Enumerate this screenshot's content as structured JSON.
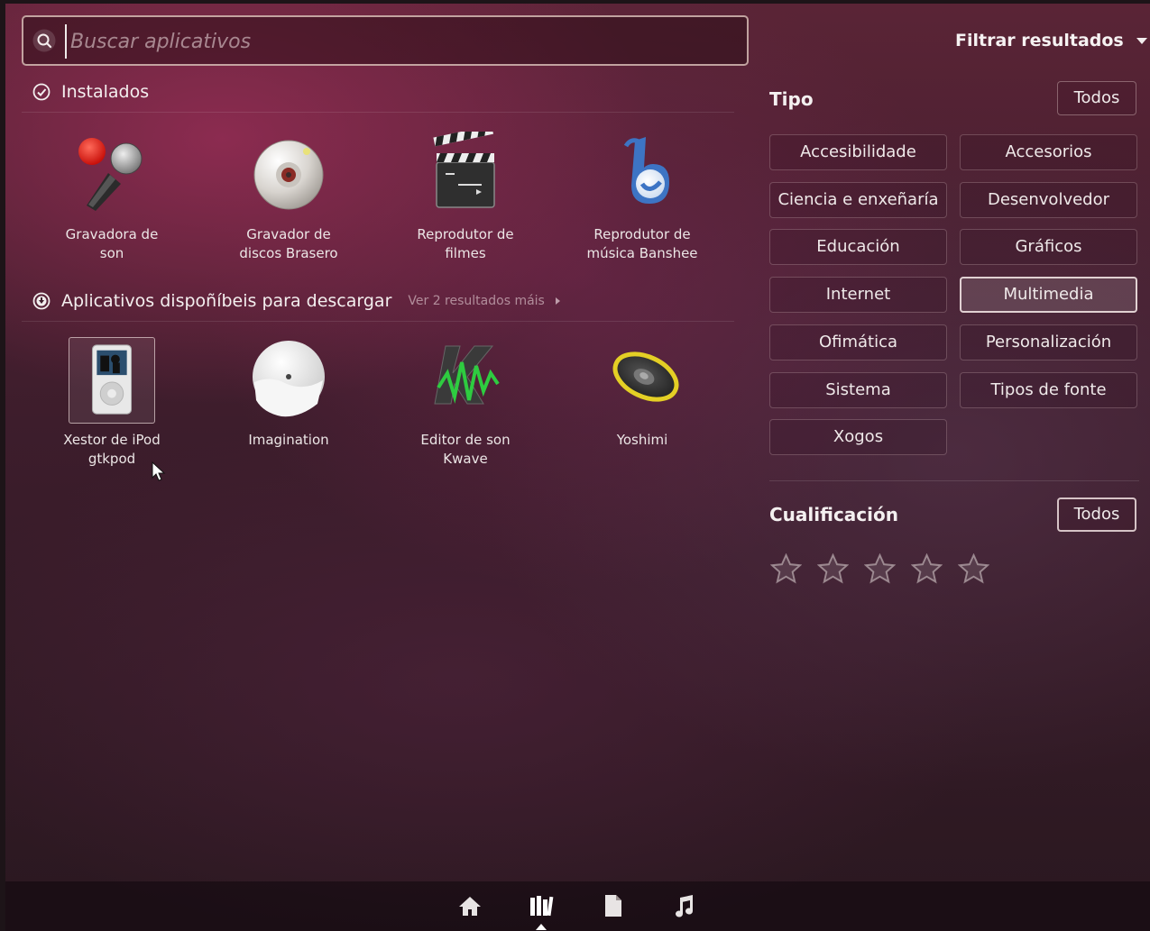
{
  "search": {
    "placeholder": "Buscar aplicativos",
    "value": ""
  },
  "filter": {
    "header_label": "Filtrar resultados",
    "tipo": {
      "title": "Tipo",
      "all_label": "Todos",
      "options": [
        {
          "label": "Accesibilidade",
          "active": false
        },
        {
          "label": "Accesorios",
          "active": false
        },
        {
          "label": "Ciencia e enxeñaría",
          "active": false
        },
        {
          "label": "Desenvolvedor",
          "active": false
        },
        {
          "label": "Educación",
          "active": false
        },
        {
          "label": "Gráficos",
          "active": false
        },
        {
          "label": "Internet",
          "active": false
        },
        {
          "label": "Multimedia",
          "active": true
        },
        {
          "label": "Ofimática",
          "active": false
        },
        {
          "label": "Personalización",
          "active": false
        },
        {
          "label": "Sistema",
          "active": false
        },
        {
          "label": "Tipos de fonte",
          "active": false
        },
        {
          "label": "Xogos",
          "active": false
        }
      ]
    },
    "rating": {
      "title": "Cualificación",
      "all_label": "Todos",
      "stars": 5,
      "star_icon": "star-outline-icon"
    }
  },
  "installed": {
    "title": "Instalados",
    "icon": "check-circle-icon",
    "apps": [
      {
        "label": "Gravadora de\nson",
        "icon": "microphone-icon"
      },
      {
        "label": "Gravador de\ndiscos Brasero",
        "icon": "disc-burner-icon"
      },
      {
        "label": "Reprodutor de\nfilmes",
        "icon": "clapperboard-icon"
      },
      {
        "label": "Reprodutor de\nmúsica Banshee",
        "icon": "banshee-icon"
      }
    ]
  },
  "available": {
    "title": "Aplicativos dispoñíbeis para descargar",
    "icon": "download-circle-icon",
    "more_label": "Ver 2 resultados máis",
    "apps": [
      {
        "label": "Xestor de iPod\ngtkpod",
        "icon": "ipod-icon",
        "highlighted": true
      },
      {
        "label": "Imagination",
        "icon": "imagination-disc-icon",
        "highlighted": false
      },
      {
        "label": "Editor de son\nKwave",
        "icon": "kwave-icon",
        "highlighted": false
      },
      {
        "label": "Yoshimi",
        "icon": "speaker-icon",
        "highlighted": false
      }
    ]
  },
  "launcher": {
    "lenses": [
      {
        "name": "home-lens-icon",
        "active": false
      },
      {
        "name": "applications-lens-icon",
        "active": true
      },
      {
        "name": "files-lens-icon",
        "active": false
      },
      {
        "name": "music-lens-icon",
        "active": false
      }
    ]
  },
  "colors": {
    "accent_border": "#f0e1e1",
    "text": "#f2eeee",
    "background": "#3d1d2c"
  }
}
